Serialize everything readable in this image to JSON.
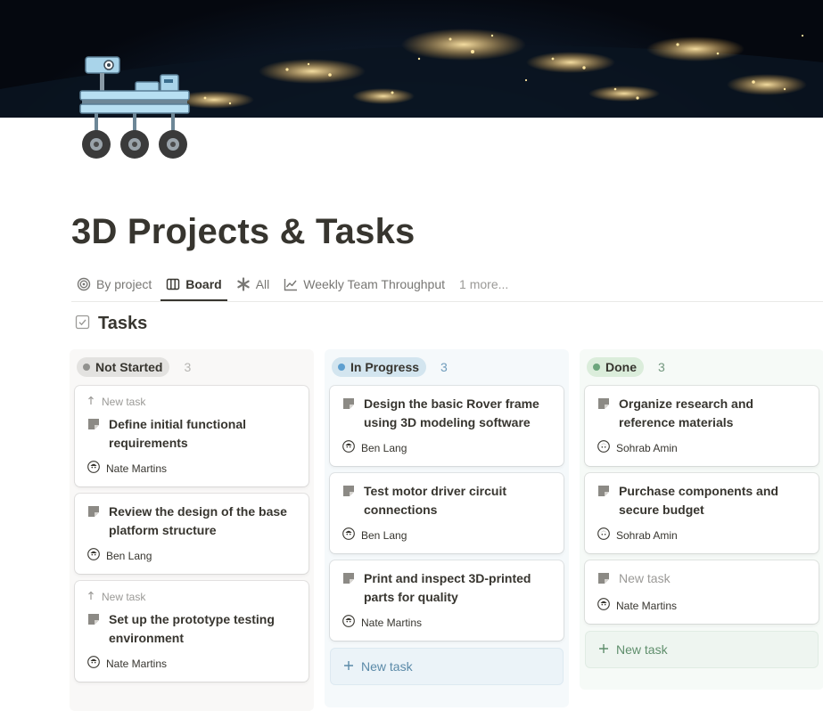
{
  "page": {
    "title": "3D Projects & Tasks"
  },
  "views": {
    "tabs": [
      {
        "label": "By project",
        "icon": "target-icon"
      },
      {
        "label": "Board",
        "icon": "board-icon",
        "active": true
      },
      {
        "label": "All",
        "icon": "asterisk-icon"
      },
      {
        "label": "Weekly Team Throughput",
        "icon": "line-chart-icon"
      }
    ],
    "more_label": "1 more..."
  },
  "database": {
    "title": "Tasks",
    "icon": "checkbox-icon"
  },
  "columns": [
    {
      "label": "Not Started",
      "count": "3",
      "colors": {
        "pill": "#e3e2e0",
        "dot": "#91918e",
        "count": "#b6b5b2"
      },
      "cards": [
        {
          "sub_label": "New task",
          "title": "Define initial functional requirements",
          "assignee": "Nate Martins"
        },
        {
          "title": "Review the design of the base platform structure",
          "assignee": "Ben Lang"
        },
        {
          "sub_label": "New task",
          "title": "Set up the prototype testing environment",
          "assignee": "Nate Martins"
        }
      ]
    },
    {
      "label": "In Progress",
      "count": "3",
      "colors": {
        "pill": "#d3e5ef",
        "dot": "#5e9fcf",
        "count": "#6f9cbb"
      },
      "cards": [
        {
          "title": "Design the basic Rover frame using 3D modeling software",
          "assignee": "Ben Lang"
        },
        {
          "title": "Test motor driver circuit connections",
          "assignee": "Ben Lang"
        },
        {
          "title": "Print and inspect 3D-printed parts for quality",
          "assignee": "Nate Martins"
        }
      ],
      "new_task_label": "New task"
    },
    {
      "label": "Done",
      "count": "3",
      "colors": {
        "pill": "#dbeddb",
        "dot": "#6ca67c",
        "count": "#72977e"
      },
      "cards": [
        {
          "title": "Organize research and reference materials",
          "assignee": "Sohrab Amin"
        },
        {
          "title": "Purchase components and secure budget",
          "assignee": "Sohrab Amin"
        },
        {
          "title": "New task",
          "assignee": "Nate Martins",
          "placeholder": true
        }
      ],
      "new_task_label": "New task"
    }
  ]
}
